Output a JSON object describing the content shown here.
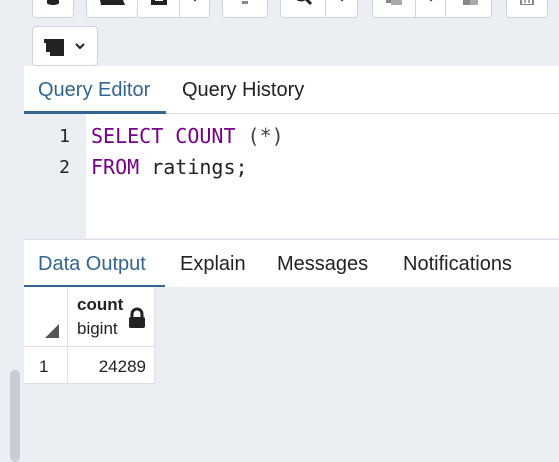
{
  "toolbar": {
    "buttons": [
      {
        "name": "database-connect",
        "icon": "database-icon"
      },
      {
        "name": "open-file",
        "icon": "folder-open-icon"
      },
      {
        "name": "save-file",
        "icon": "save-icon"
      },
      {
        "name": "filter",
        "icon": "filter-icon"
      },
      {
        "name": "search",
        "icon": "search-icon"
      },
      {
        "name": "copy",
        "icon": "copy-icon"
      },
      {
        "name": "paste",
        "icon": "paste-icon"
      },
      {
        "name": "delete",
        "icon": "trash-icon"
      },
      {
        "name": "execute-options",
        "icon": "terminal-icon"
      }
    ]
  },
  "query_tabs": [
    {
      "label": "Query Editor",
      "active": true
    },
    {
      "label": "Query History",
      "active": false
    }
  ],
  "editor": {
    "line_numbers": [
      "1",
      "2"
    ],
    "lines": [
      {
        "kw1": "SELECT",
        "kw2": "COUNT",
        "rest": " (*)"
      },
      {
        "kw1": "FROM",
        "rest": " ratings;"
      }
    ]
  },
  "output_tabs": [
    {
      "label": "Data Output",
      "active": true
    },
    {
      "label": "Explain",
      "active": false
    },
    {
      "label": "Messages",
      "active": false
    },
    {
      "label": "Notifications",
      "active": false
    }
  ],
  "result_grid": {
    "columns": [
      {
        "name": "count",
        "type": "bigint",
        "locked": true
      }
    ],
    "rows": [
      {
        "row_number": "1",
        "values": [
          "24289"
        ]
      }
    ]
  },
  "colors": {
    "accent": "#326690",
    "keyword": "#770088",
    "background": "#ebeef3"
  }
}
